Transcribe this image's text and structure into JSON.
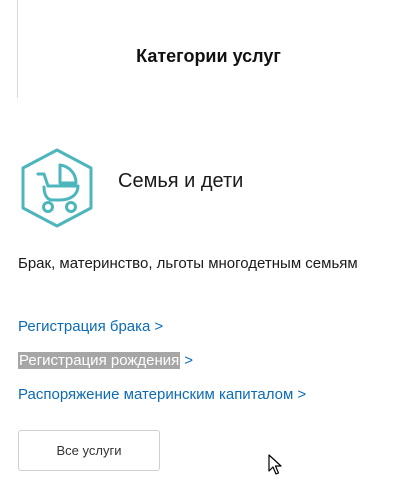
{
  "header": {
    "title": "Категории услуг"
  },
  "category": {
    "icon": "baby-stroller-icon",
    "title": "Семья и дети",
    "description": "Брак, материнство, льготы многодетным семьям",
    "accent_color": "#4db6bc"
  },
  "links": [
    {
      "label": "Регистрация брака",
      "chevron": ">"
    },
    {
      "label": "Регистрация рождения",
      "chevron": ">"
    },
    {
      "label": "Распоряжение материнским капиталом",
      "chevron": ">"
    }
  ],
  "all_services_button": {
    "label": "Все услуги"
  },
  "colors": {
    "link": "#0d6bb5",
    "highlight": "#a6a6a6"
  }
}
